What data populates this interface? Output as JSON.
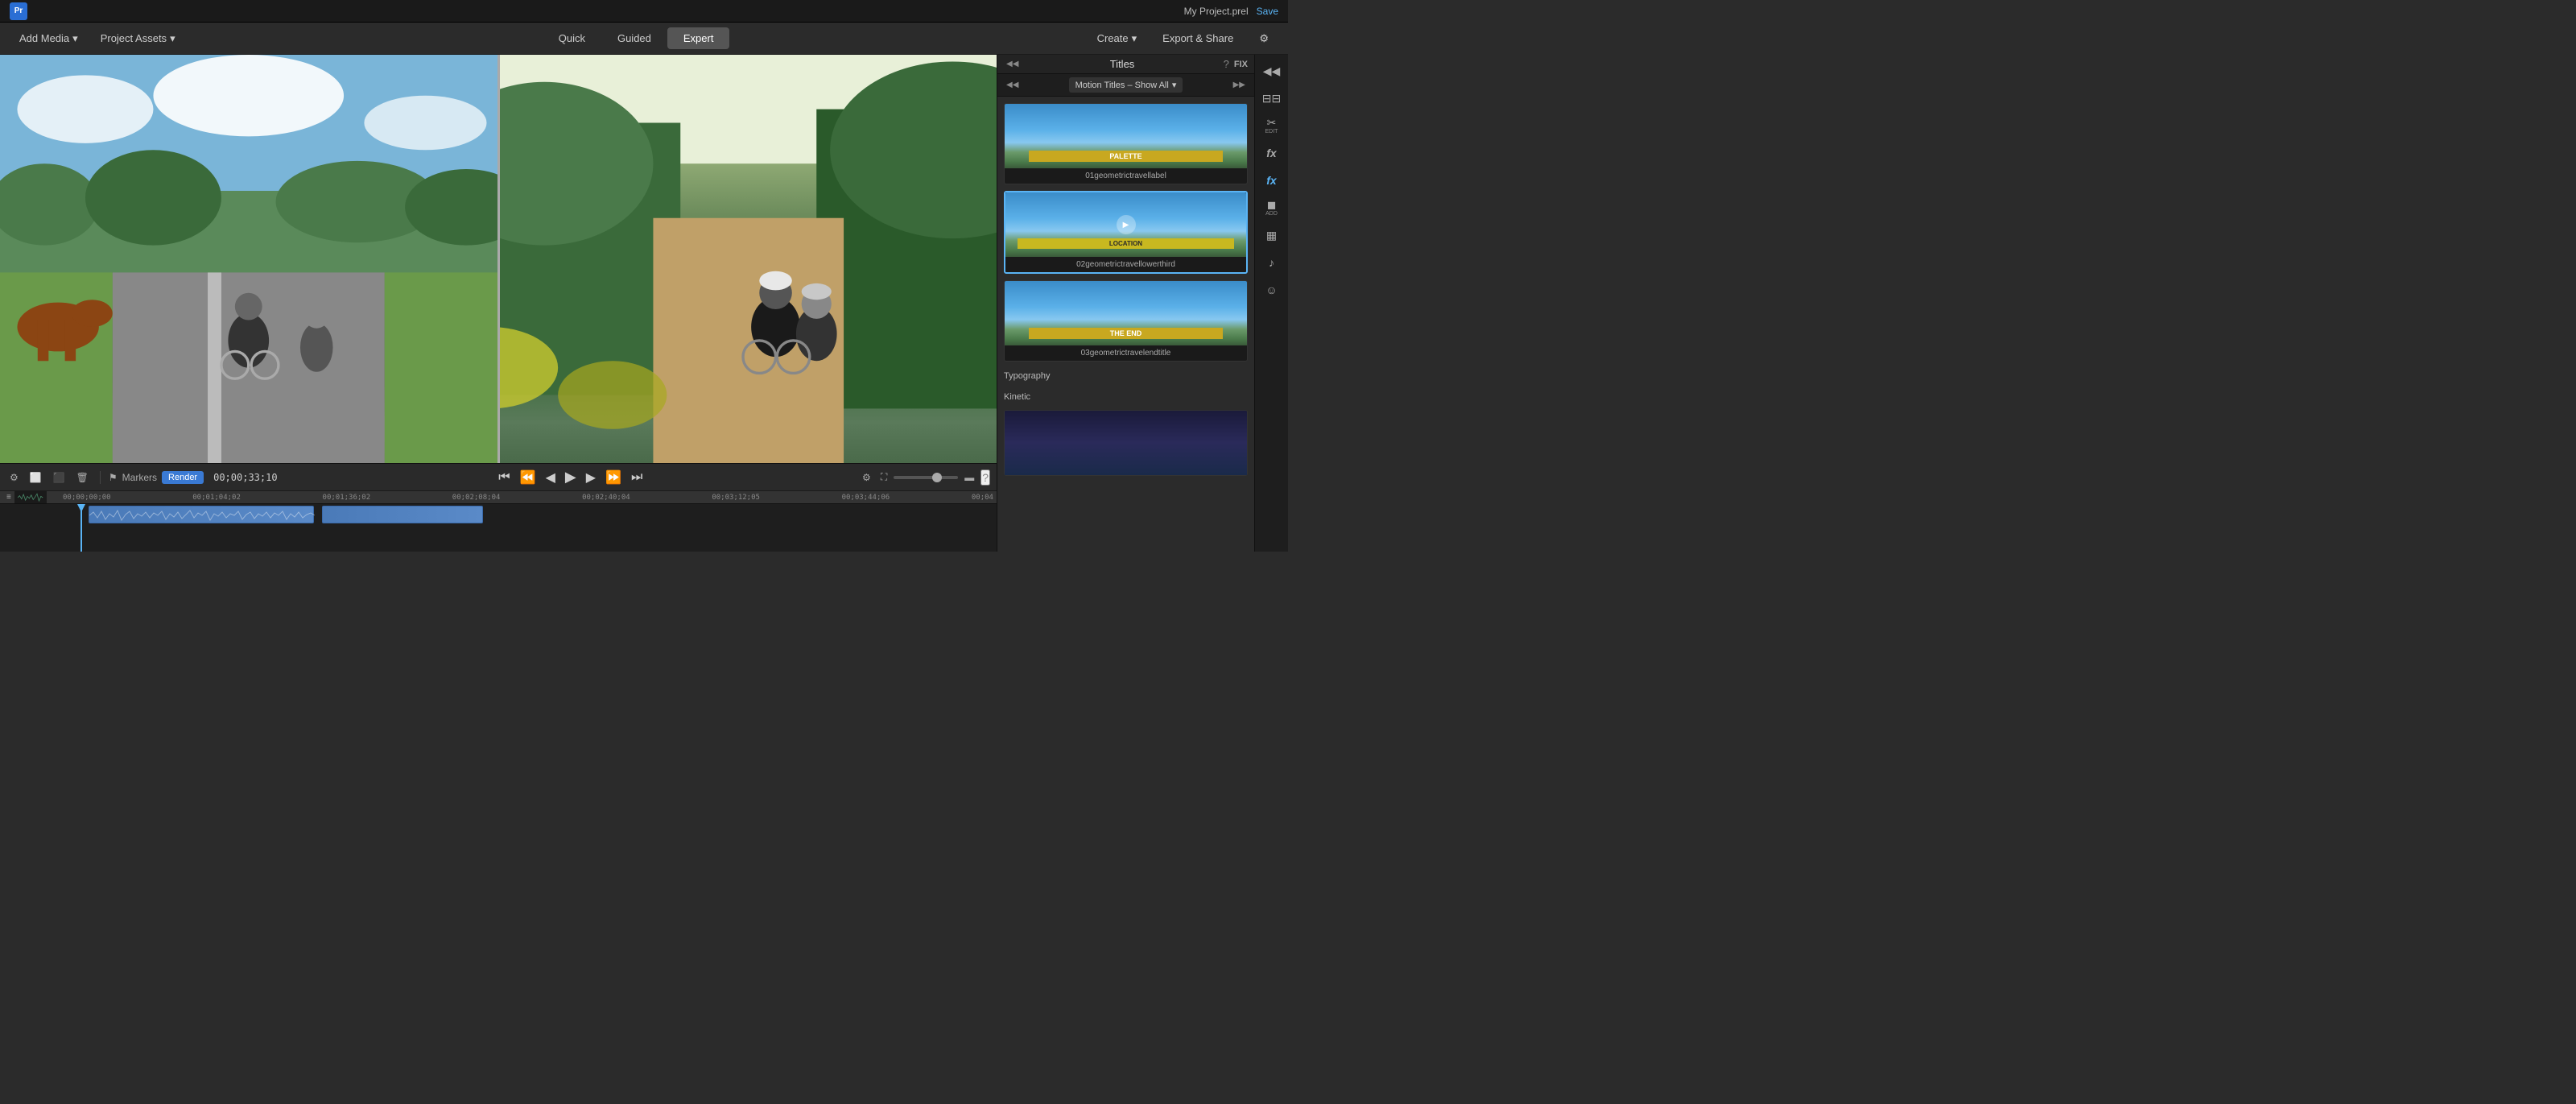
{
  "app": {
    "logo": "Pr",
    "project_name": "My Project.prel",
    "save_label": "Save"
  },
  "toolbar": {
    "add_media_label": "Add Media",
    "project_assets_label": "Project Assets",
    "quick_label": "Quick",
    "guided_label": "Guided",
    "expert_label": "Expert",
    "create_label": "Create",
    "export_share_label": "Export & Share",
    "settings_label": "⚙"
  },
  "titles_panel": {
    "title": "Titles",
    "help_icon": "?",
    "fix_label": "FIX",
    "dropdown_label": "Motion Titles – Show All",
    "items": [
      {
        "name": "01geometrictravellabel",
        "has_play": false,
        "overlay_text": "PALETTE"
      },
      {
        "name": "02geometrictravellowerthird",
        "has_play": true,
        "overlay_text": "LOCATION"
      },
      {
        "name": "03geometrictravelendtitle",
        "has_play": false,
        "overlay_text": "THE END"
      }
    ],
    "section_typography": "Typography",
    "section_kinetic": "Kinetic"
  },
  "side_icons": [
    {
      "id": "collapse-icon",
      "sym": "◀◀",
      "label": ""
    },
    {
      "id": "expand-icon",
      "sym": "▶◀",
      "label": ""
    },
    {
      "id": "edit-icon",
      "sym": "✂",
      "label": "EDIT"
    },
    {
      "id": "fx-icon",
      "sym": "fx",
      "label": ""
    },
    {
      "id": "fx2-icon",
      "sym": "fx",
      "label": ""
    },
    {
      "id": "color-icon",
      "sym": "◼",
      "label": "ADD"
    },
    {
      "id": "film-icon",
      "sym": "🎞",
      "label": ""
    },
    {
      "id": "music-icon",
      "sym": "♪",
      "label": ""
    },
    {
      "id": "emoji-icon",
      "sym": "☺",
      "label": ""
    }
  ],
  "timeline": {
    "timecode": "00;00;33;10",
    "markers_label": "Markers",
    "render_label": "Render",
    "ruler_marks": [
      "00;00;00;00",
      "00;01;04;02",
      "00;01;36;02",
      "00;02;08;04",
      "00;02;40;04",
      "00;03;12;05",
      "00;03;44;06",
      "00;04"
    ],
    "waveform_heights": [
      3,
      5,
      8,
      12,
      6,
      4,
      9,
      15,
      10,
      7,
      5,
      8,
      12,
      9,
      6,
      4,
      7,
      11,
      8,
      5,
      3,
      6,
      10,
      14,
      8,
      5,
      7,
      9,
      6,
      4,
      8,
      12,
      10,
      7,
      5,
      9,
      13,
      8,
      6,
      4,
      7,
      11,
      9,
      5,
      3
    ]
  },
  "transport": {
    "go_start": "⏮",
    "step_back": "⏪",
    "frame_back": "◀",
    "play": "▶",
    "frame_fwd": "▶",
    "step_fwd": "⏩",
    "go_end": "⏭"
  }
}
